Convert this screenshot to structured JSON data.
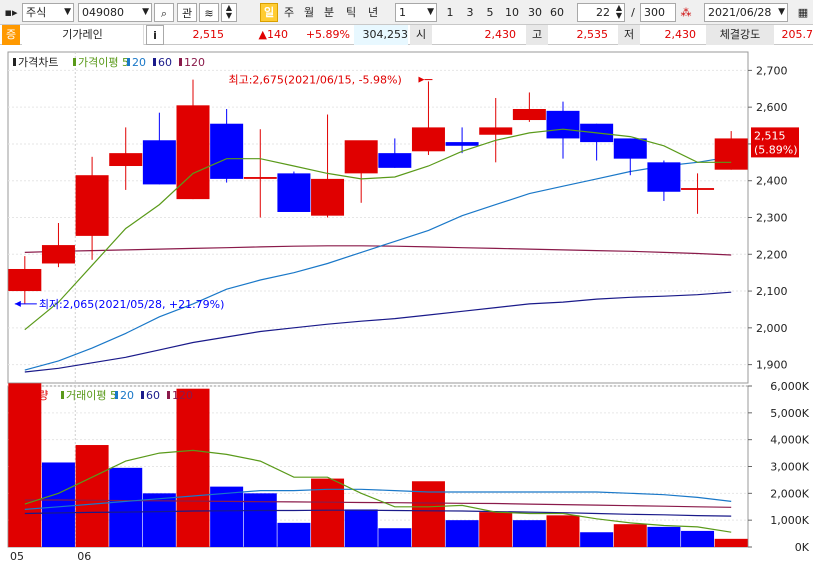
{
  "toolbar": {
    "market": "주식",
    "code": "049080",
    "search_icon": "search-icon",
    "watch_label": "관",
    "periods": [
      "일",
      "주",
      "월",
      "분",
      "틱",
      "년"
    ],
    "active_period": "일",
    "interval_value": "1",
    "quick_intervals": [
      "1",
      "3",
      "5",
      "10",
      "30",
      "60"
    ],
    "visible_count": "22",
    "separator": "/",
    "total_count": "300",
    "date": "2021/06/28"
  },
  "quote": {
    "flag": "증",
    "name": "기가레인",
    "info_label": "i",
    "price": "2,515",
    "change": "▲140",
    "change_pct": "+5.89%",
    "volume": "304,253",
    "open_label": "시",
    "open": "2,430",
    "high_label": "고",
    "high": "2,535",
    "low_label": "저",
    "low": "2,430",
    "strength_label": "체결강도",
    "strength": "205.7"
  },
  "colors": {
    "up": "#e00000",
    "down": "#0000ff",
    "ma5": "#5a9a1a",
    "ma20": "#1a78c8",
    "ma60": "#1a1a8a",
    "ma120": "#8a1a4a"
  },
  "chart_data": [
    {
      "type": "candlestick",
      "legend": [
        {
          "name": "가격차트",
          "color": "#222222"
        },
        {
          "name": "가격이평 5",
          "color": "#5a9a1a"
        },
        {
          "name": "20",
          "color": "#1a78c8"
        },
        {
          "name": "60",
          "color": "#1a1a8a"
        },
        {
          "name": "120",
          "color": "#8a1a4a"
        }
      ],
      "ylim": [
        1850,
        2750
      ],
      "yticks": [
        1900,
        2000,
        2100,
        2200,
        2300,
        2400,
        2500,
        2600,
        2700
      ],
      "ytick_labels": [
        "1,900",
        "2,000",
        "2,100",
        "2,200",
        "2,300",
        "2,400",
        "2,500",
        "2,600",
        "2,700"
      ],
      "candles": [
        {
          "o": 2100,
          "h": 2195,
          "l": 2065,
          "c": 2160
        },
        {
          "o": 2175,
          "h": 2285,
          "l": 2165,
          "c": 2225
        },
        {
          "o": 2250,
          "h": 2465,
          "l": 2185,
          "c": 2415
        },
        {
          "o": 2440,
          "h": 2545,
          "l": 2375,
          "c": 2475
        },
        {
          "o": 2510,
          "h": 2585,
          "l": 2390,
          "c": 2390
        },
        {
          "o": 2350,
          "h": 2675,
          "l": 2350,
          "c": 2605
        },
        {
          "o": 2555,
          "h": 2595,
          "l": 2395,
          "c": 2405
        },
        {
          "o": 2405,
          "h": 2540,
          "l": 2300,
          "c": 2410
        },
        {
          "o": 2420,
          "h": 2425,
          "l": 2315,
          "c": 2315
        },
        {
          "o": 2305,
          "h": 2580,
          "l": 2300,
          "c": 2405
        },
        {
          "o": 2420,
          "h": 2505,
          "l": 2340,
          "c": 2510
        },
        {
          "o": 2475,
          "h": 2515,
          "l": 2435,
          "c": 2435
        },
        {
          "o": 2480,
          "h": 2670,
          "l": 2470,
          "c": 2545
        },
        {
          "o": 2505,
          "h": 2545,
          "l": 2475,
          "c": 2495
        },
        {
          "o": 2525,
          "h": 2625,
          "l": 2450,
          "c": 2545
        },
        {
          "o": 2565,
          "h": 2640,
          "l": 2560,
          "c": 2595
        },
        {
          "o": 2590,
          "h": 2615,
          "l": 2460,
          "c": 2515
        },
        {
          "o": 2555,
          "h": 2555,
          "l": 2455,
          "c": 2505
        },
        {
          "o": 2515,
          "h": 2515,
          "l": 2415,
          "c": 2460
        },
        {
          "o": 2450,
          "h": 2455,
          "l": 2345,
          "c": 2370
        },
        {
          "o": 2375,
          "h": 2420,
          "l": 2310,
          "c": 2380
        },
        {
          "o": 2430,
          "h": 2535,
          "l": 2430,
          "c": 2515
        }
      ],
      "ma5": [
        1995,
        2070,
        2170,
        2270,
        2335,
        2420,
        2460,
        2460,
        2440,
        2420,
        2405,
        2410,
        2440,
        2480,
        2510,
        2530,
        2540,
        2530,
        2520,
        2495,
        2450,
        2450
      ],
      "ma20": [
        1885,
        1910,
        1945,
        1985,
        2030,
        2065,
        2105,
        2130,
        2150,
        2175,
        2205,
        2235,
        2265,
        2305,
        2335,
        2365,
        2385,
        2405,
        2425,
        2440,
        2450,
        2465
      ],
      "ma60": [
        1880,
        1890,
        1905,
        1920,
        1940,
        1960,
        1975,
        1990,
        2000,
        2010,
        2018,
        2025,
        2035,
        2045,
        2055,
        2065,
        2070,
        2078,
        2083,
        2086,
        2090,
        2097
      ],
      "ma120": [
        2205,
        2208,
        2210,
        2212,
        2214,
        2216,
        2218,
        2220,
        2222,
        2223,
        2223,
        2222,
        2220,
        2218,
        2216,
        2214,
        2212,
        2210,
        2208,
        2205,
        2202,
        2198
      ],
      "annotations": {
        "high": "최고:2,675(2021/06/15, -5.98%)",
        "low": "최저:2,065(2021/05/28, +21.79%)"
      },
      "last_price_label": "2,515",
      "last_pct_label": "(5.89%)"
    },
    {
      "type": "bar",
      "legend": [
        {
          "name": "거래량",
          "color": "#e00000"
        },
        {
          "name": "거래이평 5",
          "color": "#5a9a1a"
        },
        {
          "name": "20",
          "color": "#1a78c8"
        },
        {
          "name": "60",
          "color": "#1a1a8a"
        },
        {
          "name": "120",
          "color": "#8a1a4a"
        }
      ],
      "ylim": [
        0,
        6000000
      ],
      "yticks": [
        0,
        1000000,
        2000000,
        3000000,
        4000000,
        5000000,
        6000000
      ],
      "ytick_labels": [
        "0K",
        "1,000K",
        "2,000K",
        "3,000K",
        "4,000K",
        "5,000K",
        "6,000K"
      ],
      "values": [
        6100000,
        3150000,
        3800000,
        2950000,
        2000000,
        5900000,
        2250000,
        2000000,
        900000,
        2550000,
        1400000,
        700000,
        2450000,
        1000000,
        1300000,
        1000000,
        1180000,
        550000,
        850000,
        750000,
        600000,
        304253
      ],
      "ma5": [
        1600000,
        2000000,
        2600000,
        3200000,
        3500000,
        3600000,
        3450000,
        3200000,
        2600000,
        2600000,
        2000000,
        1500000,
        1500000,
        1550000,
        1300000,
        1250000,
        1250000,
        1050000,
        900000,
        800000,
        750000,
        550000
      ],
      "ma20": [
        1400000,
        1500000,
        1600000,
        1700000,
        1800000,
        1900000,
        2000000,
        2100000,
        2100000,
        2150000,
        2150000,
        2100000,
        2050000,
        2050000,
        2050000,
        2050000,
        2050000,
        2050000,
        2000000,
        1950000,
        1850000,
        1700000
      ],
      "ma60": [
        1250000,
        1270000,
        1290000,
        1300000,
        1320000,
        1340000,
        1350000,
        1360000,
        1360000,
        1370000,
        1370000,
        1360000,
        1350000,
        1340000,
        1320000,
        1300000,
        1280000,
        1250000,
        1220000,
        1200000,
        1170000,
        1150000
      ],
      "ma120": [
        1750000,
        1750000,
        1740000,
        1730000,
        1720000,
        1710000,
        1700000,
        1690000,
        1680000,
        1670000,
        1660000,
        1650000,
        1640000,
        1630000,
        1620000,
        1600000,
        1580000,
        1560000,
        1540000,
        1520000,
        1500000,
        1480000
      ],
      "up": [
        true,
        false,
        true,
        false,
        false,
        true,
        false,
        false,
        false,
        true,
        false,
        false,
        true,
        false,
        true,
        false,
        true,
        false,
        true,
        false,
        false,
        true
      ]
    }
  ],
  "x_labels": [
    {
      "index": 0,
      "label": "05"
    },
    {
      "index": 2,
      "label": "06"
    }
  ]
}
